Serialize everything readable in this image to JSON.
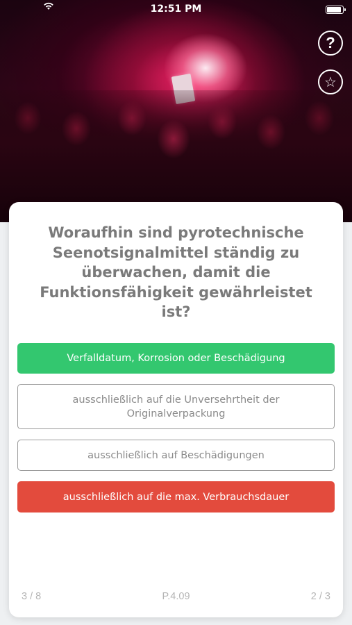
{
  "status_bar": {
    "carrier": "",
    "time": "12:51 PM"
  },
  "icons": {
    "help": "?",
    "star": "☆"
  },
  "question": {
    "text": "Woraufhin sind pyrotechnische Seenotsignalmittel ständig zu überwachen, damit die Funktionsfähigkeit gewährleistet ist?"
  },
  "answers": [
    {
      "label": "Verfalldatum, Korrosion oder Beschädigung",
      "state": "correct",
      "color": "#33c76f"
    },
    {
      "label": "ausschließlich auf die Unversehrtheit der Originalverpackung",
      "state": "neutral"
    },
    {
      "label": "ausschließlich auf Beschädigungen",
      "state": "neutral"
    },
    {
      "label": "ausschließlich auf die max. Verbrauchsdauer",
      "state": "wrong",
      "color": "#e34b3d"
    }
  ],
  "footer": {
    "progress": "3 / 8",
    "code": "P.4.09",
    "answer_index": "2 / 3"
  }
}
